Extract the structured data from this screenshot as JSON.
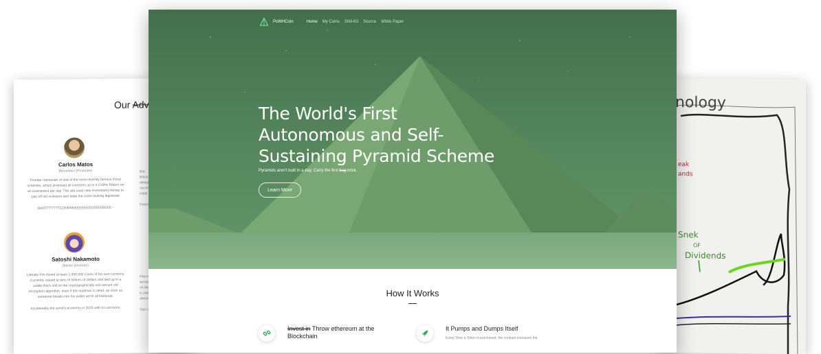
{
  "advisors_card": {
    "title_prefix": "Our",
    "title_strike": "Advi",
    "advisors": [
      {
        "name": "Carlos Matos",
        "role": "Bitconnect (Promoter)",
        "bio": "Pioneer memester of one of the most recently famous Ponzi schemes, which promised all investors up to a 0.99% Return on an investment per day. The site used new-investment money to pay off old investors and keep the scam looking legitimate",
        "tail": "BIIIIITTTTTTTCONNNNEEEEEEEEEEEEEEEE~"
      },
      {
        "name": "Satoshi Nakamoto",
        "role": "Bitcoin (Inventor)",
        "bio": "Literally Pre-mined at least 1,000,000 Coins of his own currency. Currently valued at tens of billions of dollars and tied up in a wallet that's still on the cryptographically non-secure old encryption algorithm, even if the madman is dead, as soon as someone breaks into his wallet we're all bankrupt.",
        "tail": "Accidentally the world's economy in 2025 with no survivors."
      }
    ],
    "col2_top": [
      "Bitc",
      "Bitcoi",
      "designed",
      "out of th",
      "initial d",
      "",
      "Doesn't"
    ],
    "col2_bottom": [
      "Fee-mar",
      "turning le",
      "on the de",
      "is undou",
      "doesn't w",
      "",
      "Sips cham"
    ]
  },
  "nav": {
    "brand": "PoWHCoin",
    "items": [
      "Home",
      "My Coins",
      "Shill-Kit",
      "Source",
      "White Paper"
    ]
  },
  "hero": {
    "headline": "The World's First Autonomous and Self-Sustaining Pyramid Scheme",
    "sub_prefix": "Pyramids aren't built in a day. Carry the first",
    "sub_strike": "bag",
    "sub_suffix": "brick.",
    "button": "Learn More"
  },
  "how": {
    "title": "How It Works",
    "feature1": {
      "strike": "Invest in",
      "title": "Throw ethereum at the Blockchain",
      "icon": "link-icon"
    },
    "feature2": {
      "title": "It Pumps and Dumps Itself",
      "desc": "Every Time a Token is purchased, the contract increases the",
      "icon": "rocket-icon"
    }
  },
  "drawing": {
    "heading": "nology",
    "label_red": "eak\nands",
    "label_green_1": "Snek",
    "label_green_2": "OF",
    "label_green_3": "Dividends"
  },
  "colors": {
    "hero_green": "#5b8f63",
    "accent": "#35a85a"
  }
}
